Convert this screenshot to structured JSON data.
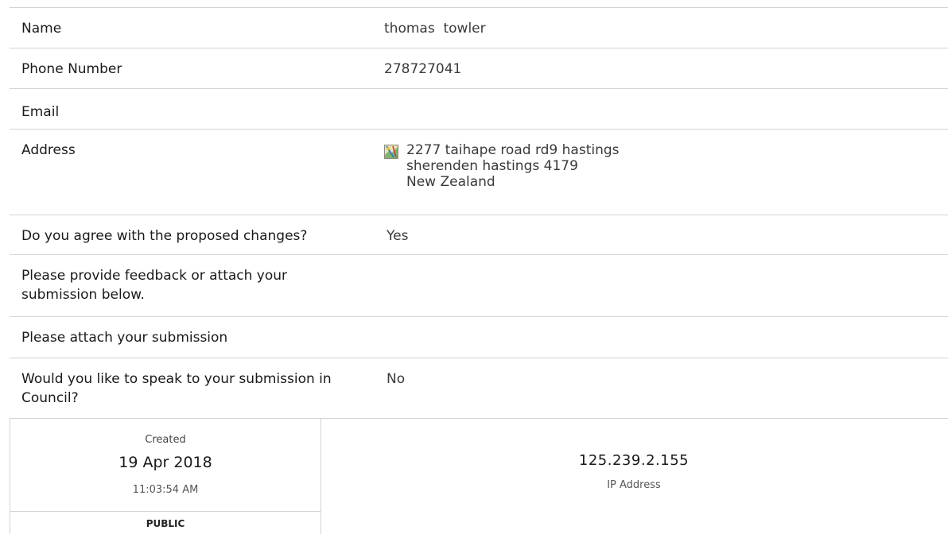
{
  "fields": {
    "name": {
      "label": "Name",
      "value": "thomas  towler"
    },
    "phone": {
      "label": "Phone Number",
      "value": "278727041"
    },
    "email": {
      "label": "Email",
      "value": ""
    },
    "address": {
      "label": "Address",
      "icon": "map-icon",
      "lines": [
        "2277 taihape road rd9 hastings",
        "sherenden hastings 4179",
        "New Zealand"
      ]
    },
    "agree": {
      "label": "Do you agree with the proposed changes?",
      "value": "Yes"
    },
    "feedback": {
      "label": "Please provide feedback or attach your submission below.",
      "value": ""
    },
    "attach": {
      "label": "Please attach your submission",
      "value": ""
    },
    "speak": {
      "label": "Would you like to speak to your submission in Council?",
      "value": "No"
    }
  },
  "meta": {
    "created_label": "Created",
    "created_date": "19 Apr 2018",
    "created_time": "11:03:54 AM",
    "visibility": "PUBLIC",
    "ip": "125.239.2.155",
    "ip_label": "IP Address"
  }
}
